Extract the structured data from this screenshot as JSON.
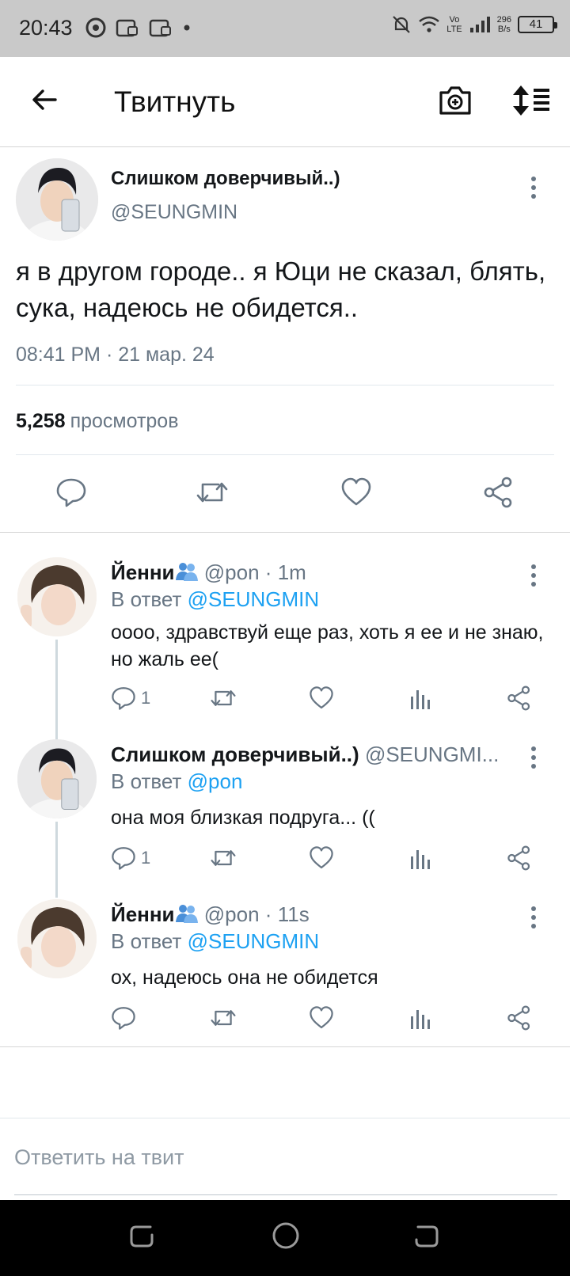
{
  "status_bar": {
    "time": "20:43",
    "net_speed_value": "296",
    "net_speed_unit": "B/s",
    "network_label_top": "Vo",
    "network_label_bottom": "LTE",
    "battery": "41"
  },
  "header": {
    "title": "Твитнуть"
  },
  "main_tweet": {
    "author_name": "Слишком доверчивый..)",
    "author_handle": "@SEUNGMIN",
    "text": "я в другом городе.. я Юци не сказал, блять, сука, надеюсь не обидется..",
    "timestamp": "08:41 PM · 21 мар. 24",
    "views_count": "5,258",
    "views_label": "просмотров"
  },
  "replies": [
    {
      "name": "Йенни",
      "handle": "@pon",
      "time": "1m",
      "replying_to_label": "В ответ",
      "replying_to": "@SEUNGMIN",
      "text": "оооо, здравствуй еще раз, хоть я ее и не знаю, но жаль ее(",
      "reply_count": "1"
    },
    {
      "name": "Слишком доверчивый..)",
      "handle": "@SEUNGMI...",
      "time": "",
      "replying_to_label": "В ответ",
      "replying_to": "@pon",
      "text": "она моя близкая подруга... ((",
      "reply_count": "1"
    },
    {
      "name": "Йенни",
      "handle": "@pon",
      "time": "11s",
      "replying_to_label": "В ответ",
      "replying_to": "@SEUNGMIN",
      "text": "ох, надеюсь она не обидется",
      "reply_count": ""
    }
  ],
  "reply_input": {
    "placeholder": "Ответить на твит"
  },
  "colors": {
    "accent": "#1da1f2",
    "secondary_text": "#687684",
    "status_bar_bg": "#c9c9c9",
    "nav_bar_bg": "#000000"
  },
  "icons": {
    "header": [
      "back-arrow-icon",
      "camera-plus-icon",
      "sort-icon"
    ],
    "actions": [
      "reply-icon",
      "retweet-icon",
      "like-icon",
      "views-icon",
      "share-icon"
    ]
  }
}
